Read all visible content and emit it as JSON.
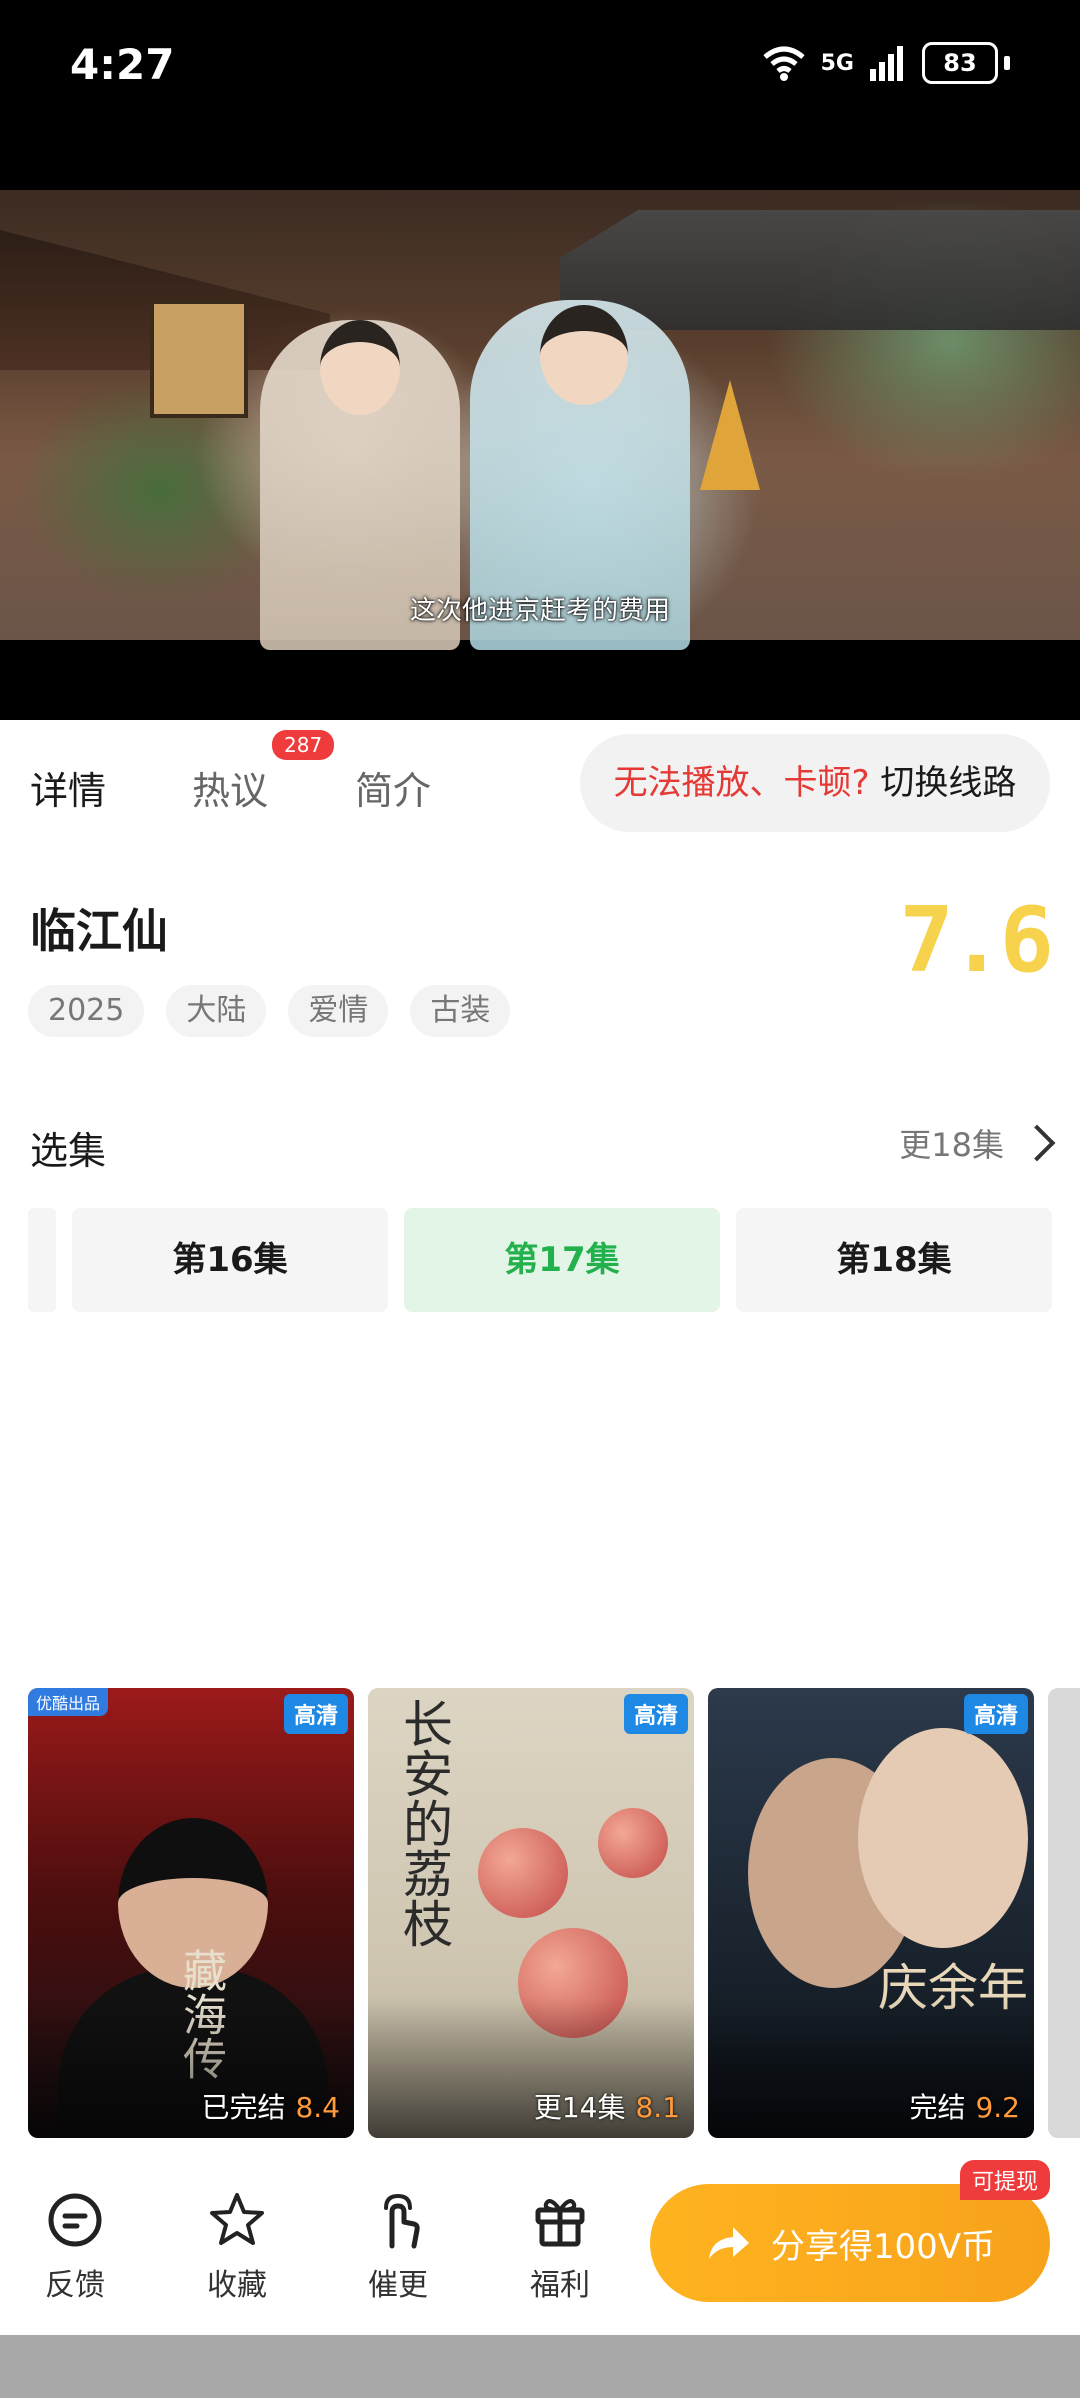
{
  "status_bar": {
    "time": "4:27",
    "battery": "83",
    "network": "5G"
  },
  "video": {
    "subtitle": "这次他进京赶考的费用"
  },
  "tabs": [
    {
      "label": "详情",
      "active": true
    },
    {
      "label": "热议",
      "badge": "287"
    },
    {
      "label": "简介"
    }
  ],
  "switch_line": {
    "warning": "无法播放、卡顿?",
    "action": "切换线路"
  },
  "show": {
    "title": "临江仙",
    "score": "7.6",
    "tags": [
      "2025",
      "大陆",
      "爱情",
      "古装"
    ]
  },
  "episodes_section": {
    "title": "选集",
    "more_label": "更18集",
    "episodes": [
      {
        "label": "第16集",
        "selected": false
      },
      {
        "label": "第17集",
        "selected": true
      },
      {
        "label": "第18集",
        "selected": false
      }
    ]
  },
  "recommendations": [
    {
      "title_art": "藏海传",
      "badge": "高清",
      "corner": "优酷出品",
      "status": "已完结",
      "score": "8.4"
    },
    {
      "title_art": "长安的荔枝",
      "badge": "高清",
      "status": "更14集",
      "score": "8.1"
    },
    {
      "title_art": "庆余年",
      "badge": "高清",
      "status": "完结",
      "score": "9.2"
    }
  ],
  "bottom_nav": {
    "items": [
      {
        "label": "反馈",
        "icon": "feedback-icon"
      },
      {
        "label": "收藏",
        "icon": "star-icon"
      },
      {
        "label": "催更",
        "icon": "hand-icon"
      },
      {
        "label": "福利",
        "icon": "gift-icon"
      }
    ],
    "share_label": "分享得100V币",
    "share_badge": "可提现"
  },
  "colors": {
    "accent_green": "#22b14c",
    "warn_red": "#e53935",
    "score_yellow": "#f6d24d",
    "share_orange": "#ffb31f"
  }
}
